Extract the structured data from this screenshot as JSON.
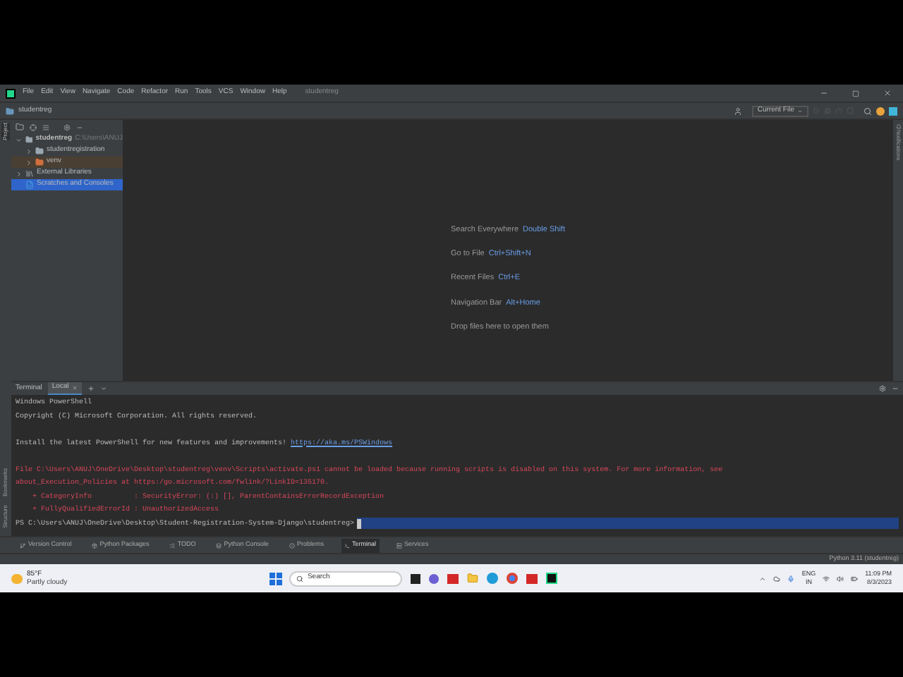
{
  "window": {
    "menu": [
      "File",
      "Edit",
      "View",
      "Navigate",
      "Code",
      "Refactor",
      "Run",
      "Tools",
      "VCS",
      "Window",
      "Help"
    ],
    "title": "studentreg"
  },
  "breadcrumb": "studentreg",
  "toolbar": {
    "run_config": "Current File"
  },
  "side_tabs_left": [
    {
      "label": "Project",
      "selected": true
    },
    {
      "label": "Bookmarks",
      "selected": false
    },
    {
      "label": "Structure",
      "selected": false
    }
  ],
  "side_tabs_right": [
    "Notifications"
  ],
  "project_tree": [
    {
      "label": "studentreg",
      "path": "C:\\Users\\ANUJ",
      "expanded": true,
      "kind": "folder",
      "selected": false,
      "children": [
        {
          "label": "studentregistration",
          "expanded": false,
          "kind": "folder",
          "selected": false
        },
        {
          "label": "venv",
          "expanded": false,
          "kind": "excluded",
          "selected": false
        }
      ]
    },
    {
      "label": "External Libraries",
      "expanded": false,
      "kind": "library",
      "selected": false
    },
    {
      "label": "Scratches and Consoles",
      "kind": "scratch",
      "selected": true
    }
  ],
  "editor_hints": [
    {
      "label": "Search Everywhere",
      "shortcut": "Double Shift"
    },
    {
      "label": "Go to File",
      "shortcut": "Ctrl+Shift+N"
    },
    {
      "label": "Recent Files",
      "shortcut": "Ctrl+E"
    },
    {
      "label": "Navigation Bar",
      "shortcut": "Alt+Home"
    }
  ],
  "drop_hint": "Drop files here to open them",
  "terminal": {
    "title": "Terminal",
    "tabs": [
      {
        "label": "Local",
        "selected": true
      }
    ],
    "lines": [
      {
        "kind": "plain",
        "text": "Windows PowerShell"
      },
      {
        "kind": "plain",
        "text": "Copyright (C) Microsoft Corporation. All rights reserved."
      },
      {
        "kind": "blank"
      },
      {
        "kind": "plain",
        "text": "Install the latest PowerShell for new features and improvements! ",
        "link": "https://aka.ms/PSWindows"
      },
      {
        "kind": "blank"
      },
      {
        "kind": "error",
        "text": "File C:\\Users\\ANUJ\\OneDrive\\Desktop\\studentreg\\venv\\Scripts\\activate.ps1 cannot be loaded because running scripts is disabled on this system. For more information, see"
      },
      {
        "kind": "error",
        "text": "about_Execution_Policies at https:/go.microsoft.com/fwlink/?LinkID=135170."
      },
      {
        "kind": "error",
        "text": "    + CategoryInfo          : SecurityError: (:) [], ParentContainsErrorRecordException"
      },
      {
        "kind": "error",
        "text": "    + FullyQualifiedErrorId : UnauthorizedAccess"
      },
      {
        "kind": "prompt",
        "text": "PS C:\\Users\\ANUJ\\OneDrive\\Desktop\\Student-Registration-System-Django\\studentreg>"
      }
    ]
  },
  "tool_windows": [
    {
      "label": "Version Control",
      "selected": false
    },
    {
      "label": "Python Packages",
      "selected": false
    },
    {
      "label": "TODO",
      "selected": false
    },
    {
      "label": "Python Console",
      "selected": false
    },
    {
      "label": "Problems",
      "selected": false
    },
    {
      "label": "Terminal",
      "selected": true
    },
    {
      "label": "Services",
      "selected": false
    }
  ],
  "status_bar": {
    "interpreter": "Python 3.11 (studentreg)"
  },
  "taskbar": {
    "temperature": "85°F",
    "weather": "Partly cloudy",
    "search": "Search",
    "language": "ENG",
    "region": "IN",
    "time": "11:09 PM",
    "date": "8/3/2023"
  }
}
